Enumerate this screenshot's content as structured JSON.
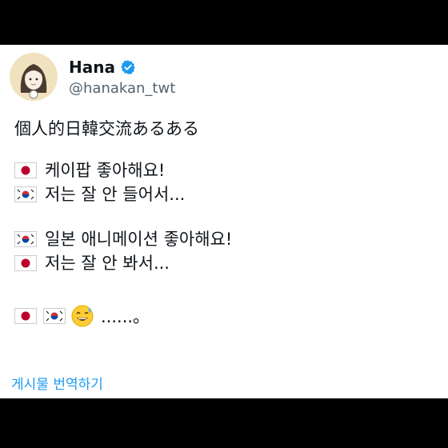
{
  "author": {
    "name": "Hana",
    "handle": "@hanakan_twt",
    "verified_icon": "verified-badge-icon",
    "verified_color": "#1d9bf0"
  },
  "post": {
    "title_line": "個人的日韓交流あるある",
    "exchange1": [
      {
        "flag": "japan-flag-icon",
        "text": "케이팝 좋아해요!"
      },
      {
        "flag": "korea-flag-icon",
        "text": "저는 잘 안 들어서..."
      }
    ],
    "exchange2": [
      {
        "flag": "korea-flag-icon",
        "text": "일본 애니메이션 좋아해요!"
      },
      {
        "flag": "japan-flag-icon",
        "text": "저는 잘 안 봐서..."
      }
    ],
    "closing": {
      "icons": [
        "japan-flag-icon",
        "korea-flag-icon",
        "sweat-smile-emoji-icon"
      ],
      "text": "......。"
    }
  },
  "translate_label": "게시물 번역하기",
  "colors": {
    "text": "#0f1419",
    "secondary": "#536471",
    "link": "#1d9bf0",
    "background": "#ffffff",
    "letterbox": "#000000"
  }
}
